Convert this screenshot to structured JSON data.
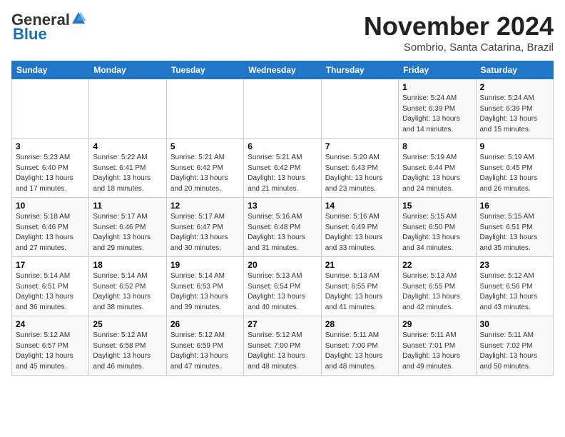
{
  "logo": {
    "general": "General",
    "blue": "Blue"
  },
  "header": {
    "month_title": "November 2024",
    "location": "Sombrio, Santa Catarina, Brazil"
  },
  "weekdays": [
    "Sunday",
    "Monday",
    "Tuesday",
    "Wednesday",
    "Thursday",
    "Friday",
    "Saturday"
  ],
  "weeks": [
    [
      {
        "day": "",
        "info": ""
      },
      {
        "day": "",
        "info": ""
      },
      {
        "day": "",
        "info": ""
      },
      {
        "day": "",
        "info": ""
      },
      {
        "day": "",
        "info": ""
      },
      {
        "day": "1",
        "info": "Sunrise: 5:24 AM\nSunset: 6:39 PM\nDaylight: 13 hours\nand 14 minutes."
      },
      {
        "day": "2",
        "info": "Sunrise: 5:24 AM\nSunset: 6:39 PM\nDaylight: 13 hours\nand 15 minutes."
      }
    ],
    [
      {
        "day": "3",
        "info": "Sunrise: 5:23 AM\nSunset: 6:40 PM\nDaylight: 13 hours\nand 17 minutes."
      },
      {
        "day": "4",
        "info": "Sunrise: 5:22 AM\nSunset: 6:41 PM\nDaylight: 13 hours\nand 18 minutes."
      },
      {
        "day": "5",
        "info": "Sunrise: 5:21 AM\nSunset: 6:42 PM\nDaylight: 13 hours\nand 20 minutes."
      },
      {
        "day": "6",
        "info": "Sunrise: 5:21 AM\nSunset: 6:42 PM\nDaylight: 13 hours\nand 21 minutes."
      },
      {
        "day": "7",
        "info": "Sunrise: 5:20 AM\nSunset: 6:43 PM\nDaylight: 13 hours\nand 23 minutes."
      },
      {
        "day": "8",
        "info": "Sunrise: 5:19 AM\nSunset: 6:44 PM\nDaylight: 13 hours\nand 24 minutes."
      },
      {
        "day": "9",
        "info": "Sunrise: 5:19 AM\nSunset: 6:45 PM\nDaylight: 13 hours\nand 26 minutes."
      }
    ],
    [
      {
        "day": "10",
        "info": "Sunrise: 5:18 AM\nSunset: 6:46 PM\nDaylight: 13 hours\nand 27 minutes."
      },
      {
        "day": "11",
        "info": "Sunrise: 5:17 AM\nSunset: 6:46 PM\nDaylight: 13 hours\nand 29 minutes."
      },
      {
        "day": "12",
        "info": "Sunrise: 5:17 AM\nSunset: 6:47 PM\nDaylight: 13 hours\nand 30 minutes."
      },
      {
        "day": "13",
        "info": "Sunrise: 5:16 AM\nSunset: 6:48 PM\nDaylight: 13 hours\nand 31 minutes."
      },
      {
        "day": "14",
        "info": "Sunrise: 5:16 AM\nSunset: 6:49 PM\nDaylight: 13 hours\nand 33 minutes."
      },
      {
        "day": "15",
        "info": "Sunrise: 5:15 AM\nSunset: 6:50 PM\nDaylight: 13 hours\nand 34 minutes."
      },
      {
        "day": "16",
        "info": "Sunrise: 5:15 AM\nSunset: 6:51 PM\nDaylight: 13 hours\nand 35 minutes."
      }
    ],
    [
      {
        "day": "17",
        "info": "Sunrise: 5:14 AM\nSunset: 6:51 PM\nDaylight: 13 hours\nand 36 minutes."
      },
      {
        "day": "18",
        "info": "Sunrise: 5:14 AM\nSunset: 6:52 PM\nDaylight: 13 hours\nand 38 minutes."
      },
      {
        "day": "19",
        "info": "Sunrise: 5:14 AM\nSunset: 6:53 PM\nDaylight: 13 hours\nand 39 minutes."
      },
      {
        "day": "20",
        "info": "Sunrise: 5:13 AM\nSunset: 6:54 PM\nDaylight: 13 hours\nand 40 minutes."
      },
      {
        "day": "21",
        "info": "Sunrise: 5:13 AM\nSunset: 6:55 PM\nDaylight: 13 hours\nand 41 minutes."
      },
      {
        "day": "22",
        "info": "Sunrise: 5:13 AM\nSunset: 6:55 PM\nDaylight: 13 hours\nand 42 minutes."
      },
      {
        "day": "23",
        "info": "Sunrise: 5:12 AM\nSunset: 6:56 PM\nDaylight: 13 hours\nand 43 minutes."
      }
    ],
    [
      {
        "day": "24",
        "info": "Sunrise: 5:12 AM\nSunset: 6:57 PM\nDaylight: 13 hours\nand 45 minutes."
      },
      {
        "day": "25",
        "info": "Sunrise: 5:12 AM\nSunset: 6:58 PM\nDaylight: 13 hours\nand 46 minutes."
      },
      {
        "day": "26",
        "info": "Sunrise: 5:12 AM\nSunset: 6:59 PM\nDaylight: 13 hours\nand 47 minutes."
      },
      {
        "day": "27",
        "info": "Sunrise: 5:12 AM\nSunset: 7:00 PM\nDaylight: 13 hours\nand 48 minutes."
      },
      {
        "day": "28",
        "info": "Sunrise: 5:11 AM\nSunset: 7:00 PM\nDaylight: 13 hours\nand 48 minutes."
      },
      {
        "day": "29",
        "info": "Sunrise: 5:11 AM\nSunset: 7:01 PM\nDaylight: 13 hours\nand 49 minutes."
      },
      {
        "day": "30",
        "info": "Sunrise: 5:11 AM\nSunset: 7:02 PM\nDaylight: 13 hours\nand 50 minutes."
      }
    ]
  ]
}
